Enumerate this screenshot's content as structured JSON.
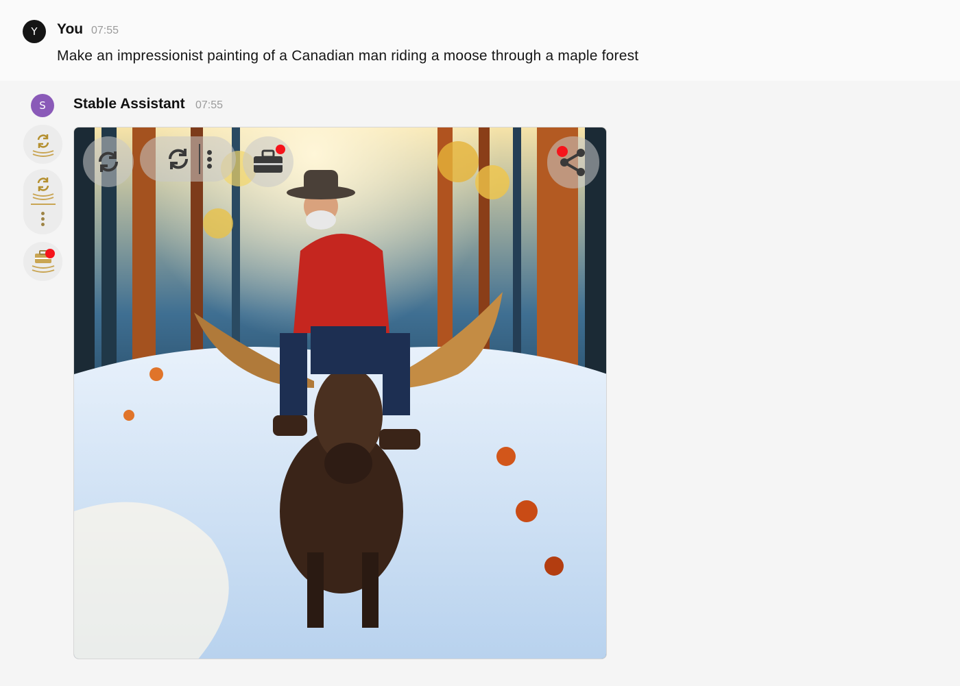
{
  "user_message": {
    "avatar_letter": "Y",
    "name": "You",
    "time": "07:55",
    "text": "Make an impressionist painting of a Canadian man riding a moose through a maple forest"
  },
  "assistant_message": {
    "avatar_letter": "S",
    "name": "Stable Assistant",
    "time": "07:55",
    "image_alt": "Impressionist painting of a bearded man in a red jacket and cowboy hat riding a moose through a snowy forest with maple leaves"
  },
  "rail": {
    "buttons": [
      {
        "name": "regenerate-all-icon"
      },
      {
        "name": "variations-icon"
      },
      {
        "name": "toolbox-icon"
      }
    ]
  },
  "image_overlay": {
    "buttons": [
      {
        "name": "regenerate-icon"
      },
      {
        "name": "variate-icon"
      },
      {
        "name": "toolbox-icon"
      },
      {
        "name": "share-icon"
      }
    ]
  },
  "colors": {
    "accent_gold": "#b48f2e",
    "notification_red": "#f5141b",
    "assistant_avatar": "#8a5ab8"
  }
}
